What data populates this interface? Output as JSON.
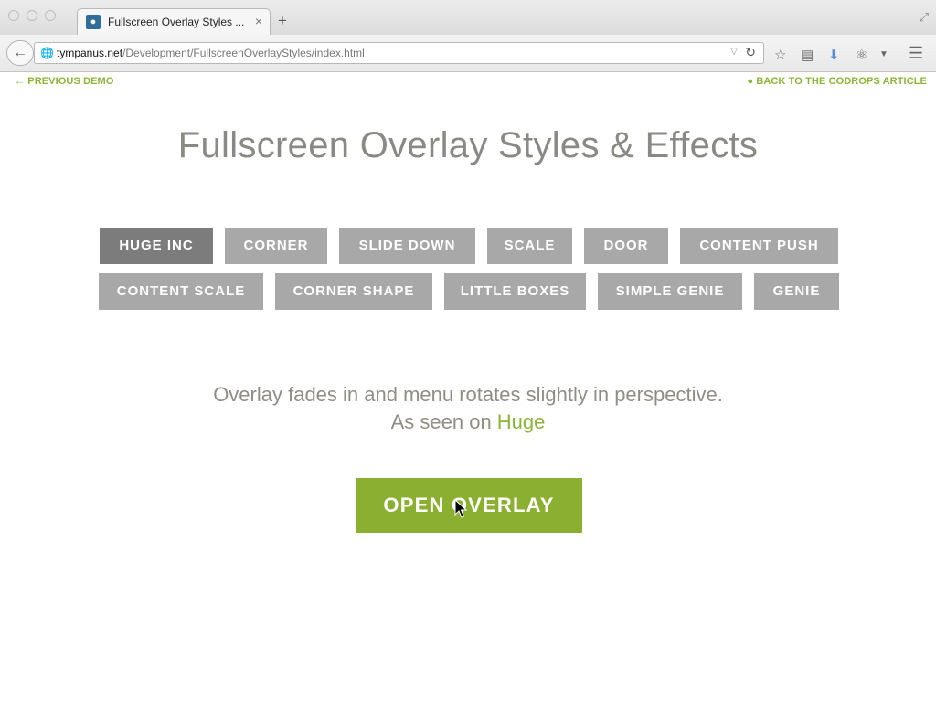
{
  "browser": {
    "tab_title": "Fullscreen Overlay Styles ...",
    "tab_close": "×",
    "new_tab": "+",
    "url_host": "tympanus.net",
    "url_path": "/Development/FullscreenOverlayStyles/index.html"
  },
  "nav": {
    "previous_demo": "PREVIOUS DEMO",
    "back_to_article": "BACK TO THE CODROPS ARTICLE"
  },
  "page": {
    "title": "Fullscreen Overlay Styles & Effects",
    "description_line1": "Overlay fades in and menu rotates slightly in perspective.",
    "description_line2_prefix": "As seen on ",
    "description_link": "Huge",
    "open_button": "OPEN OVERLAY"
  },
  "effects": {
    "row1": [
      "HUGE INC",
      "CORNER",
      "SLIDE DOWN",
      "SCALE",
      "DOOR",
      "CONTENT PUSH"
    ],
    "row2": [
      "CONTENT SCALE",
      "CORNER SHAPE",
      "LITTLE BOXES",
      "SIMPLE GENIE",
      "GENIE"
    ],
    "active": "HUGE INC"
  },
  "colors": {
    "accent": "#8bb53a",
    "button": "#a8a8a8",
    "button_active": "#7c7c7c",
    "title": "#8a8a84"
  },
  "icons": {
    "previous": "arrow-left-icon",
    "article": "drop-icon",
    "cursor": "mouse-pointer-icon"
  }
}
